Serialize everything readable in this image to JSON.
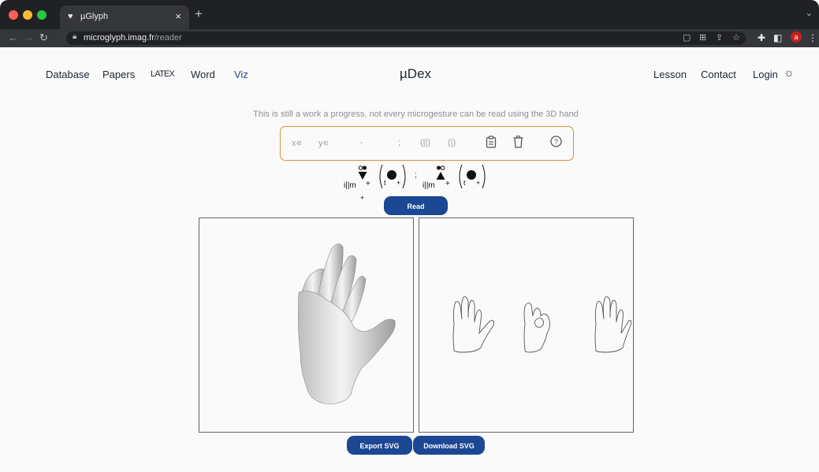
{
  "browser": {
    "tab_title": "µGlyph",
    "tab_close": "×",
    "new_tab": "+",
    "url_host": "microglyph.imag.fr",
    "url_path": "/reader",
    "profile_initial": "a"
  },
  "nav": {
    "left": [
      "Database",
      "Papers",
      "LATEX",
      "Word",
      "Viz"
    ],
    "brand": "µDex",
    "right": [
      "Lesson",
      "Contact",
      "Login"
    ]
  },
  "notice": "This is still a work a progress, not every microgesture can be read using the 3D hand",
  "input": {
    "tokens": [
      "x∊",
      "y∊",
      "-",
      ";",
      "(||)",
      "(|)"
    ]
  },
  "formula": {
    "part1_main": "i||m",
    "part1_plus": "+",
    "part1_sub_plus": "+",
    "part1_paren_letter": "t",
    "part1_paren_plus": "+",
    "separator": ";",
    "part2_main": "i||m",
    "part2_plus": "+",
    "part2_paren_letter": "t",
    "part2_paren_plus": "+"
  },
  "buttons": {
    "read": "Read",
    "export": "Export SVG",
    "download": "Download SVG"
  },
  "colors": {
    "accent_button": "#1c4793",
    "input_border": "#d7943a",
    "active_nav": "#2a4a8c"
  }
}
